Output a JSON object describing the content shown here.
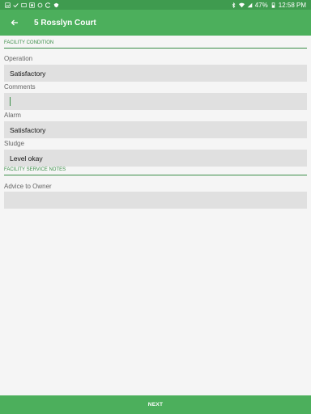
{
  "status_bar": {
    "battery": "47%",
    "time": "12:58 PM",
    "left_icons": [
      "gallery-icon",
      "check-icon",
      "image-icon",
      "face-icon",
      "settings-icon",
      "clean-icon",
      "shield-icon"
    ],
    "right_icons": [
      "bluetooth-icon",
      "wifi-icon",
      "signal-icon",
      "battery-icon"
    ]
  },
  "app_bar": {
    "title": "5 Rosslyn Court"
  },
  "sections": {
    "facility_condition": "FACILITY CONDITION",
    "facility_service_notes": "FACILITY SERVICE NOTES"
  },
  "fields": {
    "operation": {
      "label": "Operation",
      "value": "Satisfactory"
    },
    "comments": {
      "label": "Comments",
      "value": ""
    },
    "alarm": {
      "label": "Alarm",
      "value": "Satisfactory"
    },
    "sludge": {
      "label": "Sludge",
      "value": "Level okay"
    },
    "advice": {
      "label": "Advice to Owner",
      "value": ""
    }
  },
  "footer": {
    "next_label": "NEXT"
  },
  "colors": {
    "primary": "#4caf5c",
    "primary_dark": "#3f9b4f",
    "accent": "#3a8d47",
    "field_bg": "#e0e0e0"
  }
}
